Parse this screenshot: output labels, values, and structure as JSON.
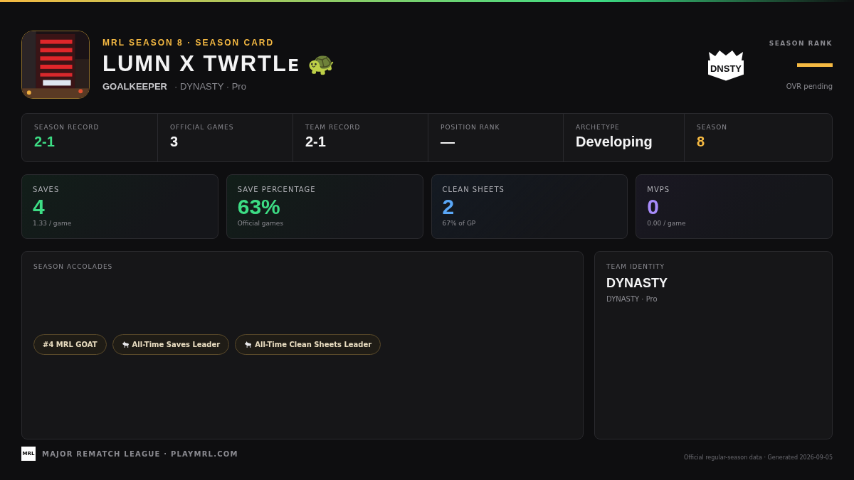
{
  "header": {
    "eyebrow": "MRL SEASON 8 · SEASON CARD",
    "player_name": "LUMN X TWRTLᴇ 🐢",
    "position": "GOALKEEPER",
    "team_line": "· DYNASTY · Pro",
    "team_logo": "DNSTY",
    "rank_label": "SEASON RANK",
    "rank_note": "OVR pending"
  },
  "summary": [
    {
      "label": "SEASON RECORD",
      "value": "2-1",
      "color": "#3ddc84"
    },
    {
      "label": "OFFICIAL GAMES",
      "value": "3",
      "color": "#f4f4f5"
    },
    {
      "label": "TEAM RECORD",
      "value": "2-1",
      "color": "#f4f4f5"
    },
    {
      "label": "POSITION RANK",
      "value": "—",
      "color": "#f4f4f5"
    },
    {
      "label": "ARCHETYPE",
      "value": "Developing",
      "color": "#f4f4f5"
    },
    {
      "label": "SEASON",
      "value": "8",
      "color": "#f5b942"
    }
  ],
  "stats": [
    {
      "label": "SAVES",
      "value": "4",
      "sub": "1.33 / game",
      "color": "#3ddc84"
    },
    {
      "label": "SAVE PERCENTAGE",
      "value": "63%",
      "sub": "Official games",
      "color": "#3ddc84"
    },
    {
      "label": "CLEAN SHEETS",
      "value": "2",
      "sub": "67% of GP",
      "color": "#5aa7f7"
    },
    {
      "label": "MVPS",
      "value": "0",
      "sub": "0.00 / game",
      "color": "#a78bfa"
    }
  ],
  "accolades": {
    "title": "SEASON ACCOLADES",
    "items": [
      {
        "label": "#4 MRL GOAT",
        "kind": "plain"
      },
      {
        "label": "All-Time Saves Leader",
        "kind": "goat"
      },
      {
        "label": "All-Time Clean Sheets Leader",
        "kind": "goat"
      }
    ]
  },
  "team_identity": {
    "title": "TEAM IDENTITY",
    "name": "DYNASTY",
    "sub": "DYNASTY · Pro"
  },
  "footer": {
    "logo": "MRL",
    "league": "MAJOR REMATCH LEAGUE · PLAYMRL.COM",
    "note": "Official regular-season data · Generated 2026-09-05"
  }
}
